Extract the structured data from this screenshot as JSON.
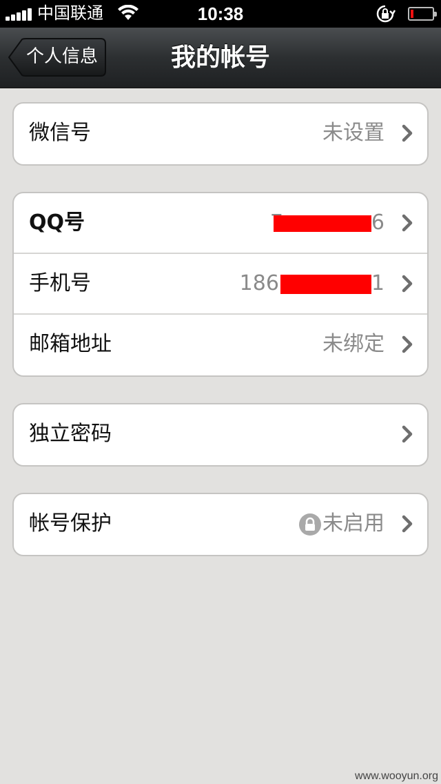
{
  "status_bar": {
    "carrier": "中国联通",
    "time": "10:38",
    "icons": [
      "signal-icon",
      "wifi-icon",
      "rotation-lock-icon",
      "battery-icon"
    ],
    "battery_level": 0.12,
    "battery_color": "#ee1111"
  },
  "nav": {
    "back_label": "个人信息",
    "title": "我的帐号"
  },
  "groups": [
    {
      "rows": [
        {
          "label": "微信号",
          "value": "未设置"
        }
      ]
    },
    {
      "rows": [
        {
          "label": "QQ号",
          "value_prefix": "7",
          "value_suffix": "6"
        },
        {
          "label": "手机号",
          "value_prefix": "186",
          "value_suffix": "1"
        },
        {
          "label": "邮箱地址",
          "value": "未绑定"
        }
      ]
    },
    {
      "rows": [
        {
          "label": "独立密码",
          "value": ""
        }
      ]
    },
    {
      "rows": [
        {
          "label": "帐号保护",
          "value": "未启用",
          "icon": "lock-icon"
        }
      ]
    }
  ],
  "watermark": "www.wooyun.org",
  "colors": {
    "background": "#e2e1df",
    "redaction": "#ff0000",
    "secondary_text": "#8a8a8a"
  }
}
